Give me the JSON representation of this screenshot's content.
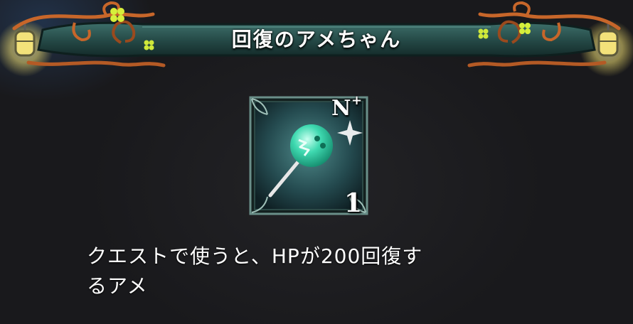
{
  "banner": {
    "title": "回復のアメちゃん"
  },
  "item": {
    "name": "回復のアメちゃん",
    "rarity": "N",
    "rarity_suffix": "+",
    "quantity": "1",
    "icon": "lollipop-icon"
  },
  "description": {
    "line1": "クエストで使うと、HPが200回復す",
    "line2": "るアメ"
  },
  "colors": {
    "background": "#1b1b1f",
    "banner_teal": "#2d5c5a",
    "banner_vine": "#c7662a",
    "frame": "#3f6b68",
    "candy": "#3fd9b0",
    "lantern": "#f3e27a"
  }
}
